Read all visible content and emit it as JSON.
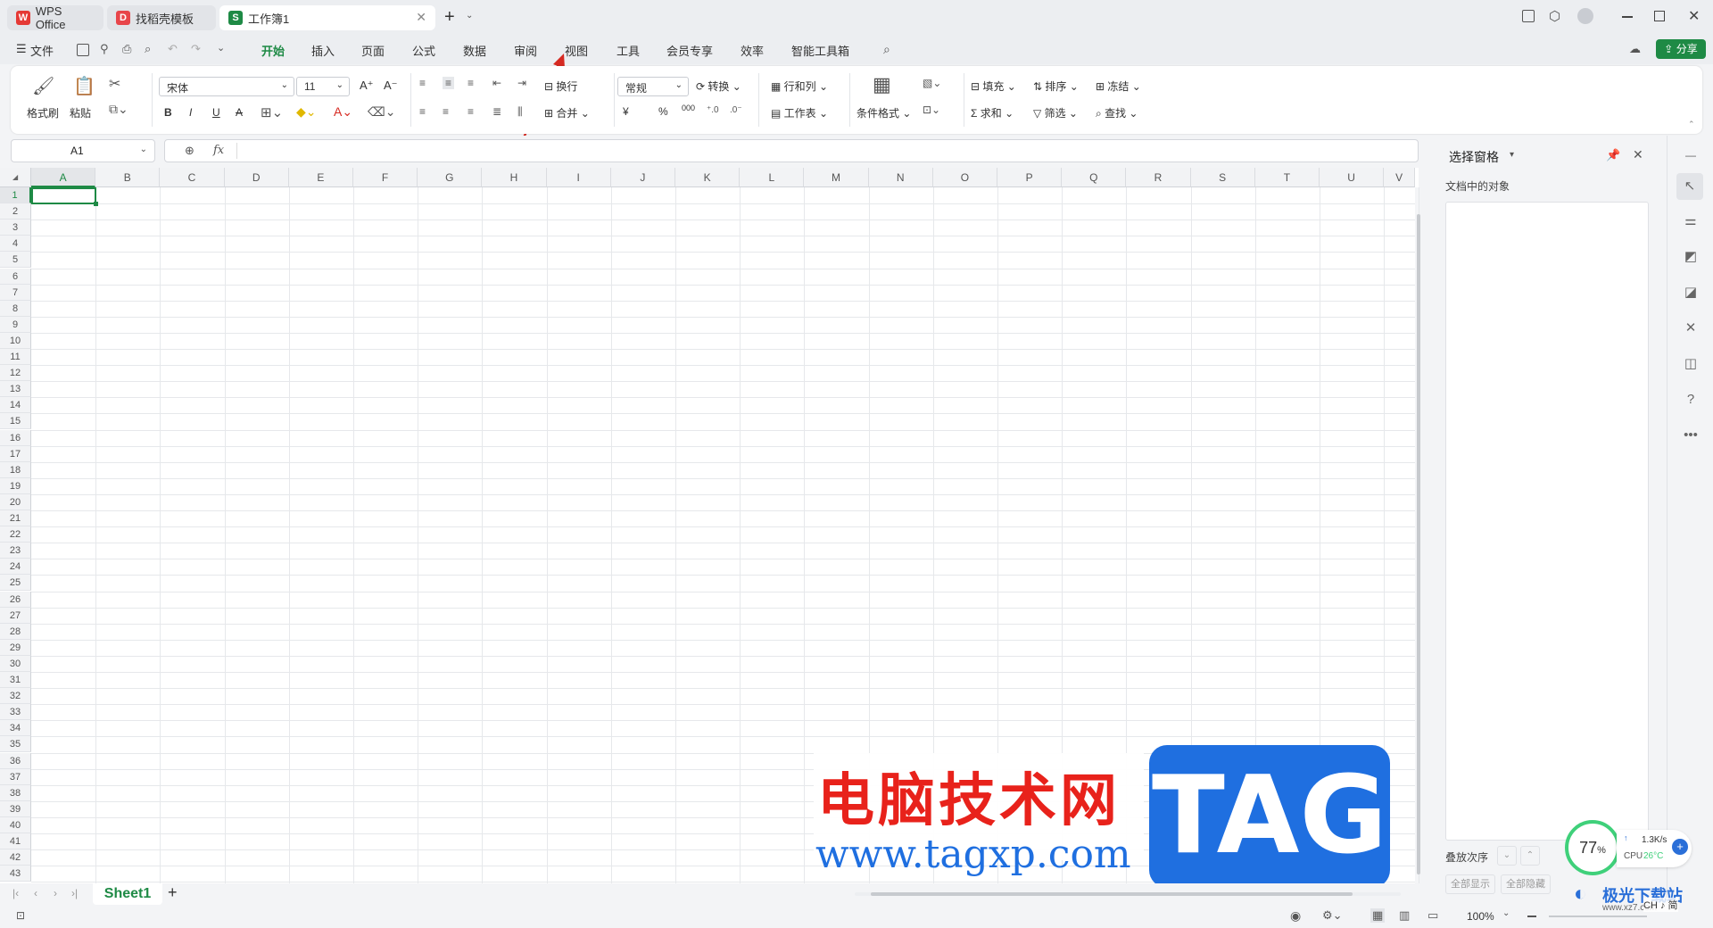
{
  "titlebar": {
    "tabs": [
      {
        "label": "WPS Office"
      },
      {
        "label": "找稻壳模板"
      },
      {
        "label": "工作簿1"
      }
    ]
  },
  "menubar": {
    "file": "文件",
    "items": [
      "开始",
      "插入",
      "页面",
      "公式",
      "数据",
      "审阅",
      "视图",
      "工具",
      "会员专享",
      "效率",
      "智能工具箱"
    ],
    "share": "分享"
  },
  "ribbon": {
    "format_painter": "格式刷",
    "paste": "粘贴",
    "font_name": "宋体",
    "font_size": "11",
    "wrap": "换行",
    "merge": "合并",
    "number_format": "常规",
    "convert": "转换",
    "rows_cols": "行和列",
    "worksheet": "工作表",
    "cond_format": "条件格式",
    "fill": "填充",
    "sort": "排序",
    "freeze": "冻结",
    "sum": "求和",
    "filter": "筛选",
    "find": "查找",
    "bold": "B",
    "italic": "I",
    "underline": "U",
    "currency": "¥",
    "percent": "%",
    "thousands": "000"
  },
  "formulabar": {
    "cell_ref": "A1",
    "fx": "fx"
  },
  "grid": {
    "columns": [
      "A",
      "B",
      "C",
      "D",
      "E",
      "F",
      "G",
      "H",
      "I",
      "J",
      "K",
      "L",
      "M",
      "N",
      "O",
      "P",
      "Q",
      "R",
      "S",
      "T",
      "U",
      "V"
    ],
    "rows": [
      "1",
      "2",
      "3",
      "4",
      "5",
      "6",
      "7",
      "8",
      "9",
      "10",
      "11",
      "12",
      "13",
      "14",
      "15",
      "16",
      "17",
      "18",
      "19",
      "20",
      "21",
      "22",
      "23",
      "24",
      "25",
      "26",
      "27",
      "28",
      "29",
      "30",
      "31",
      "32",
      "33",
      "34",
      "35",
      "36",
      "37",
      "38",
      "39",
      "40",
      "41",
      "42",
      "43"
    ]
  },
  "sheetbar": {
    "sheet": "Sheet1",
    "add": "+"
  },
  "pane": {
    "title": "选择窗格",
    "subtitle": "文档中的对象",
    "order_label": "叠放次序",
    "show_all": "全部显示",
    "hide_all": "全部隐藏"
  },
  "statusbar": {
    "zoom": "100%"
  },
  "widget": {
    "percent": "77",
    "pct_sign": "%",
    "speed": "1.3K/s",
    "cpu_label": "CPU",
    "cpu_temp": "26°C"
  },
  "watermark": {
    "cn_text": "电脑技术网",
    "url": "www.tagxp.com",
    "tag": "TAG",
    "site2": "极光下载站",
    "site2_url": "www.xz7.com"
  },
  "ime": "CH ♪ 简",
  "colors": {
    "accent_green": "#1e8a45",
    "watermark_red": "#e8221b",
    "watermark_blue": "#1f6fe0"
  }
}
